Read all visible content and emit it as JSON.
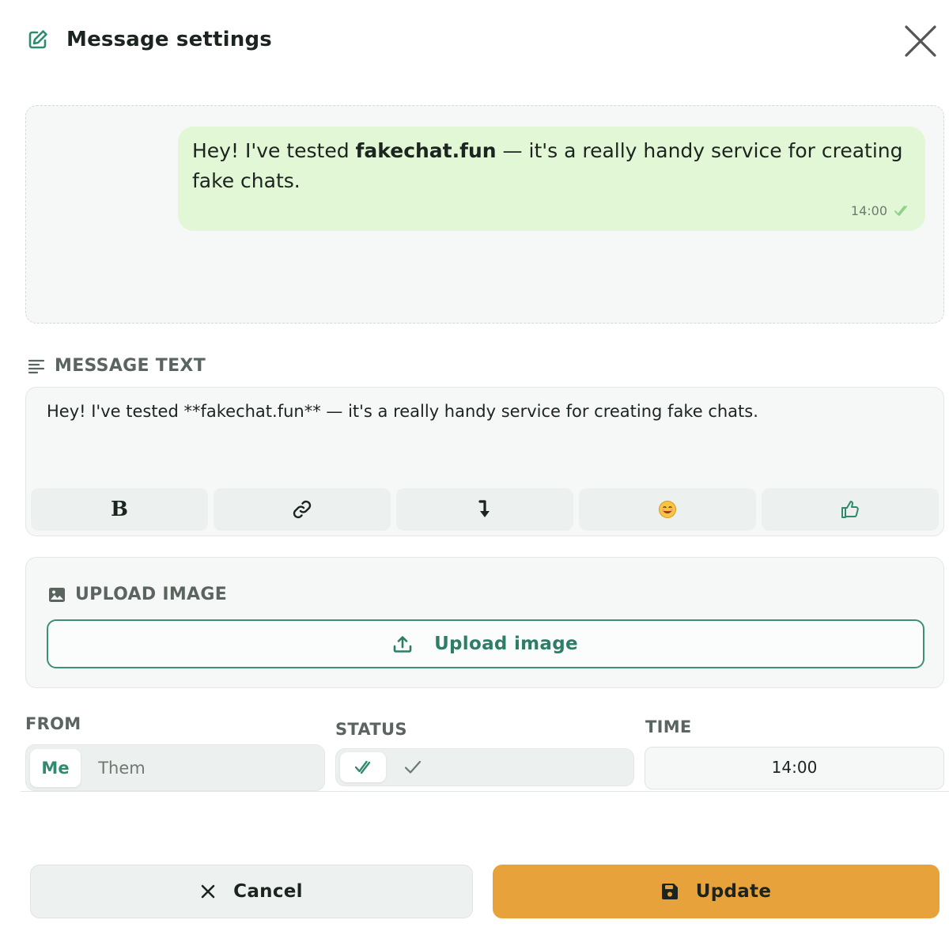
{
  "header": {
    "title": "Message settings"
  },
  "preview": {
    "text_before": "Hey! I've tested ",
    "text_bold": "fakechat.fun",
    "text_after": " — it's a really handy service for creating fake chats.",
    "time": "14:00"
  },
  "message_text": {
    "label": "MESSAGE TEXT",
    "value": "Hey! I've tested **fakechat.fun** — it's a really handy service for creating fake chats.",
    "toolbar": {
      "bold_label": "B",
      "emoji": "😊"
    }
  },
  "upload": {
    "label": "UPLOAD IMAGE",
    "button_label": "Upload image"
  },
  "from": {
    "label": "FROM",
    "options": [
      "Me",
      "Them"
    ],
    "selected": "Me"
  },
  "status": {
    "label": "STATUS",
    "selected": "double-check"
  },
  "time": {
    "label": "TIME",
    "value": "14:00"
  },
  "actions": {
    "cancel_label": "Cancel",
    "update_label": "Update"
  },
  "colors": {
    "accent": "#2f8a6e",
    "bubble": "#e2f7d5",
    "update": "#e8a23b"
  }
}
